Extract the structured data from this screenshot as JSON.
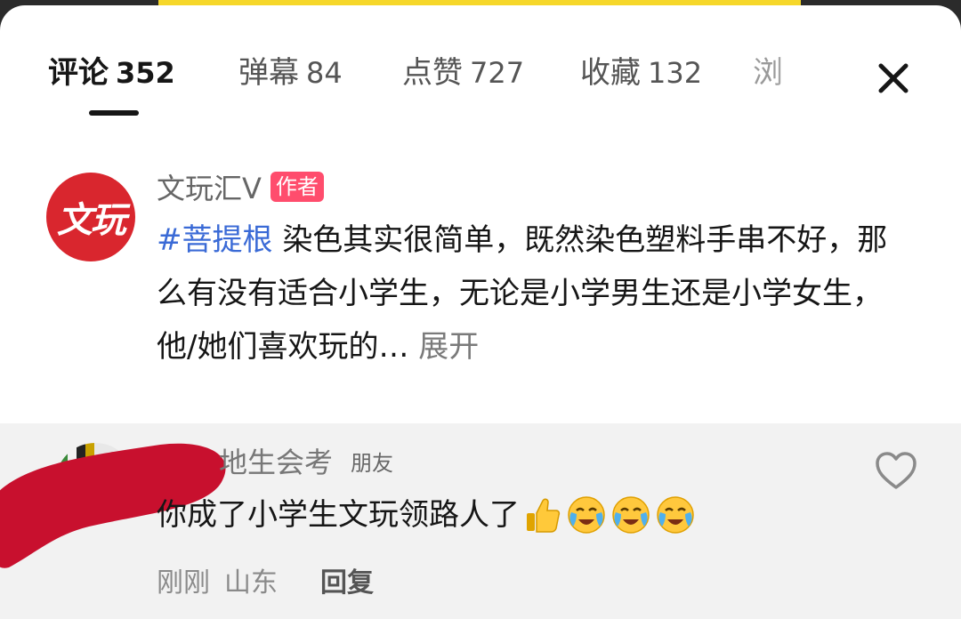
{
  "tabs": [
    {
      "label": "评论",
      "count": "352"
    },
    {
      "label": "弹幕",
      "count": "84"
    },
    {
      "label": "点赞",
      "count": "727"
    },
    {
      "label": "收藏",
      "count": "132"
    }
  ],
  "tab_overflow": "浏",
  "close_icon": "close-icon",
  "post": {
    "avatar_text": "文玩",
    "author": "文玩汇V",
    "author_badge": "作者",
    "hashtag": "#菩提根",
    "text": "染色其实很简单，既然染色塑料手串不好，那么有没有适合小学生，无论是小学男生还是小学女生，他/她们喜欢玩的…",
    "expand_label": "展开"
  },
  "reply": {
    "name": "地生会考",
    "relation_tag": "朋友",
    "text": "你成了小学生文玩领路人了",
    "emojis": [
      "thumbs-up-icon",
      "crying-face-icon",
      "crying-face-icon",
      "crying-face-icon"
    ],
    "time": "刚刚",
    "location": "山东",
    "reply_label": "回复",
    "like_icon": "heart-outline-icon"
  },
  "colors": {
    "top_accent": "#f6d72a",
    "hashtag": "#3a6ad6",
    "author_badge": "#ff4d6d",
    "avatar_bg": "#d9262e",
    "redaction": "#c8102e",
    "reply_bg": "#f2f2f2"
  }
}
